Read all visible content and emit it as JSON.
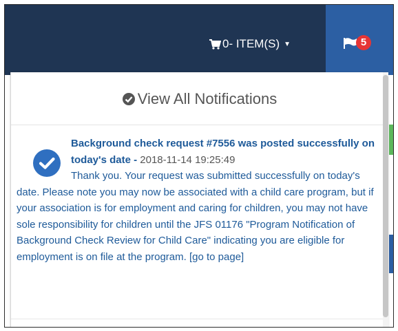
{
  "nav": {
    "cart_label": "0- ITEM(S)",
    "notification_count": "5"
  },
  "panel": {
    "view_all_label": "View All Notifications",
    "notification": {
      "title": "Background check request #7556 was posted successfully on today's date",
      "separator": " - ",
      "timestamp": "2018-11-14 19:25:49",
      "body": "Thank you. Your request was submitted successfully on today's date. Please note you may now be associated with a child care program, but if your association is for employment and caring for children, you may not have sole responsibility for children until the JFS 01176 \"Program Notification of Background Check Review for Child Care\" indicating you are eligible for employment is on file at the program.",
      "link": "[go to page]"
    }
  },
  "colors": {
    "navbar": "#1f3553",
    "flag_tab": "#2c5fa3",
    "badge": "#e63535",
    "link_blue": "#1e5a99",
    "check_blue": "#2f6fc0"
  },
  "icons": {
    "cart": "shopping-cart-icon",
    "flag": "flag-icon",
    "view_all": "check-circle-icon",
    "notification": "check-circle-icon"
  }
}
